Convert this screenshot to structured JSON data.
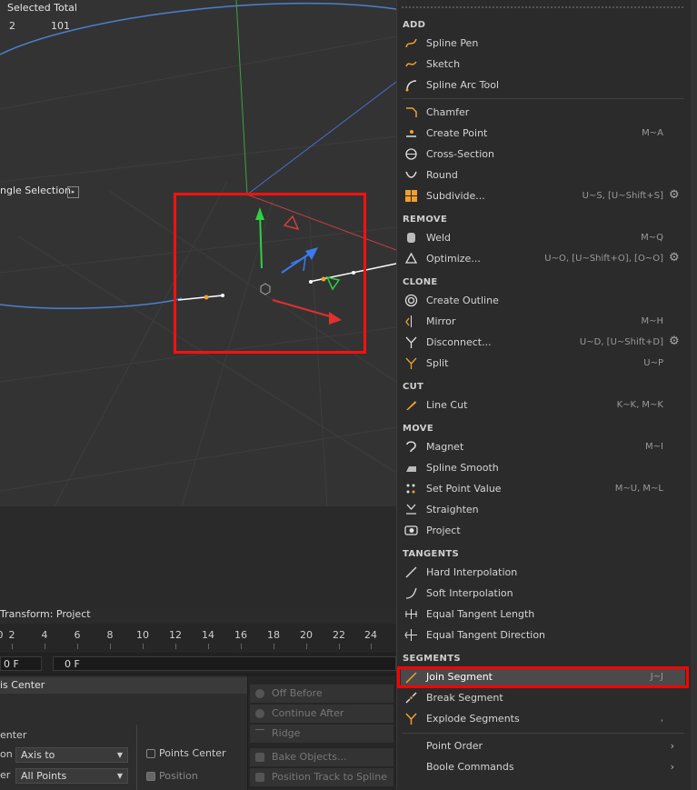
{
  "viewport": {
    "selected_total_label": "Selected Total",
    "selected_count_left": "2",
    "selected_count_right": "101",
    "hud_label": "ngle Selection"
  },
  "timeline": {
    "header": "Transform: Project",
    "ticks": [
      "0",
      "2",
      "4",
      "6",
      "8",
      "10",
      "12",
      "14",
      "16",
      "18",
      "20",
      "22",
      "24"
    ],
    "frame_left": "0 F",
    "frame_right": "0 F"
  },
  "attributes": {
    "title": "is Center",
    "section": "enter",
    "row1_label": "on",
    "row1_value": "Axis to",
    "row2_label": "er",
    "row2_value": "All Points",
    "points_center": "Points Center",
    "position": "Position"
  },
  "side_buttons": [
    "Off Before",
    "Continue After",
    "Ridge",
    "Bake Objects...",
    "Position Track to Spline"
  ],
  "menu": {
    "sections": {
      "add": "ADD",
      "remove": "REMOVE",
      "clone": "CLONE",
      "cut": "CUT",
      "move": "MOVE",
      "tangents": "TANGENTS",
      "segments": "SEGMENTS"
    },
    "add": [
      {
        "label": "Spline Pen",
        "shortcut": ""
      },
      {
        "label": "Sketch",
        "shortcut": ""
      },
      {
        "label": "Spline Arc Tool",
        "shortcut": ""
      },
      {
        "label": "Chamfer",
        "shortcut": ""
      },
      {
        "label": "Create Point",
        "shortcut": "M~A"
      },
      {
        "label": "Cross-Section",
        "shortcut": ""
      },
      {
        "label": "Round",
        "shortcut": ""
      },
      {
        "label": "Subdivide...",
        "shortcut": "U~S, [U~Shift+S]"
      }
    ],
    "remove": [
      {
        "label": "Weld",
        "shortcut": "M~Q"
      },
      {
        "label": "Optimize...",
        "shortcut": "U~O, [U~Shift+O], [O~O]"
      }
    ],
    "clone": [
      {
        "label": "Create Outline",
        "shortcut": ""
      },
      {
        "label": "Mirror",
        "shortcut": "M~H"
      },
      {
        "label": "Disconnect...",
        "shortcut": "U~D, [U~Shift+D]"
      },
      {
        "label": "Split",
        "shortcut": "U~P"
      }
    ],
    "cut": [
      {
        "label": "Line Cut",
        "shortcut": "K~K, M~K"
      }
    ],
    "move": [
      {
        "label": "Magnet",
        "shortcut": "M~I"
      },
      {
        "label": "Spline Smooth",
        "shortcut": ""
      },
      {
        "label": "Set Point Value",
        "shortcut": "M~U, M~L"
      },
      {
        "label": "Straighten",
        "shortcut": ""
      },
      {
        "label": "Project",
        "shortcut": ""
      }
    ],
    "tangents": [
      {
        "label": "Hard Interpolation",
        "shortcut": ""
      },
      {
        "label": "Soft Interpolation",
        "shortcut": ""
      },
      {
        "label": "Equal Tangent Length",
        "shortcut": ""
      },
      {
        "label": "Equal Tangent Direction",
        "shortcut": ""
      }
    ],
    "segments": [
      {
        "label": "Join Segment",
        "shortcut": "J~J"
      },
      {
        "label": "Break Segment",
        "shortcut": ""
      },
      {
        "label": "Explode Segments",
        "shortcut": ","
      }
    ],
    "more": [
      {
        "label": "Point Order"
      },
      {
        "label": "Boole Commands"
      }
    ]
  },
  "colors": {
    "highlight": "#ff0000",
    "accent_orange": "#f0a030"
  }
}
